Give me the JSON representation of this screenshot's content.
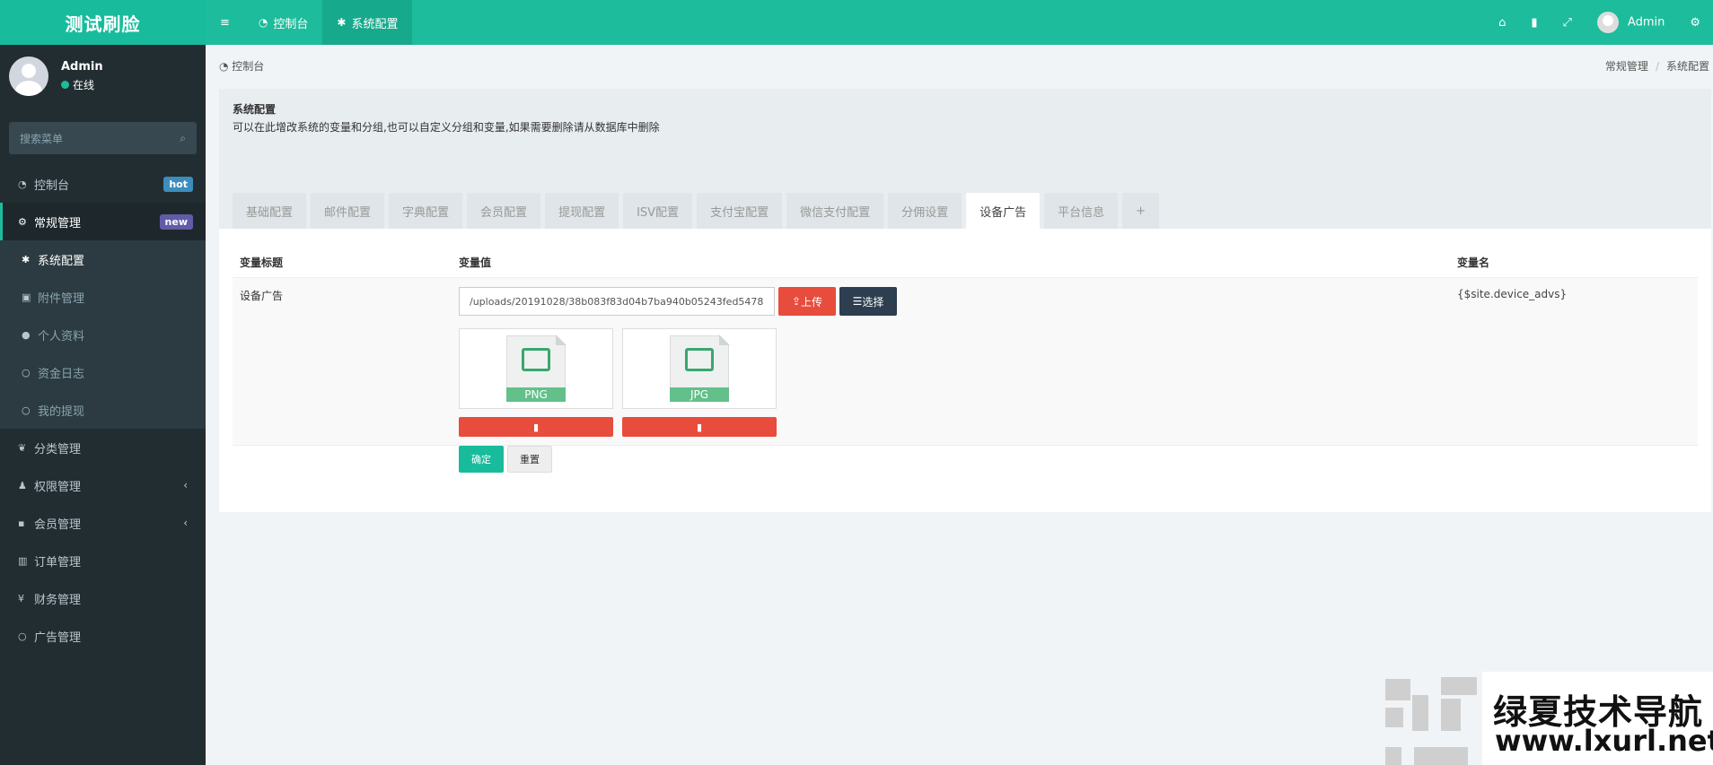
{
  "app": {
    "title": "测试刷脸"
  },
  "topnav": {
    "menu_toggle": "≡",
    "items": [
      {
        "icon": "dashboard-icon",
        "label": "控制台"
      },
      {
        "icon": "gear-icon",
        "label": "系统配置"
      }
    ],
    "right": {
      "user": "Admin"
    }
  },
  "sidebar": {
    "user": {
      "name": "Admin",
      "status": "在线"
    },
    "search_placeholder": "搜索菜单",
    "items": [
      {
        "label": "控制台",
        "badge": "hot"
      },
      {
        "label": "常规管理",
        "badge": "new"
      }
    ],
    "submenu": [
      {
        "label": "系统配置"
      },
      {
        "label": "附件管理"
      },
      {
        "label": "个人资料"
      },
      {
        "label": "资金日志"
      },
      {
        "label": "我的提现"
      }
    ],
    "items2": [
      {
        "label": "分类管理"
      },
      {
        "label": "权限管理"
      },
      {
        "label": "会员管理"
      },
      {
        "label": "订单管理"
      },
      {
        "label": "财务管理"
      },
      {
        "label": "广告管理"
      }
    ]
  },
  "breadcrumb": {
    "current": "控制台",
    "trail": [
      "常规管理",
      "系统配置"
    ]
  },
  "panel": {
    "title": "系统配置",
    "description": "可以在此增改系统的变量和分组,也可以自定义分组和变量,如果需要删除请从数据库中删除",
    "tabs": [
      "基础配置",
      "邮件配置",
      "字典配置",
      "会员配置",
      "提现配置",
      "ISV配置",
      "支付宝配置",
      "微信支付配置",
      "分佣设置",
      "设备广告",
      "平台信息",
      "+"
    ],
    "active_tab": "设备广告"
  },
  "table": {
    "headers": [
      "变量标题",
      "变量值",
      "变量名"
    ],
    "row": {
      "title": "设备广告",
      "value": "/uploads/20191028/38b083f83d04b7ba940b05243fed5478",
      "name": "{$site.device_advs}",
      "upload_label": "上传",
      "choose_label": "选择",
      "thumbs": [
        "PNG",
        "JPG"
      ]
    }
  },
  "actions": {
    "ok": "确定",
    "reset": "重置"
  },
  "watermark": {
    "cn": "绿夏技术导航",
    "en": "www.lxurl.net"
  },
  "colors": {
    "primary": "#18bc9c",
    "sidebar": "#222d32",
    "danger": "#e74c3c",
    "dark": "#2c3e50"
  }
}
